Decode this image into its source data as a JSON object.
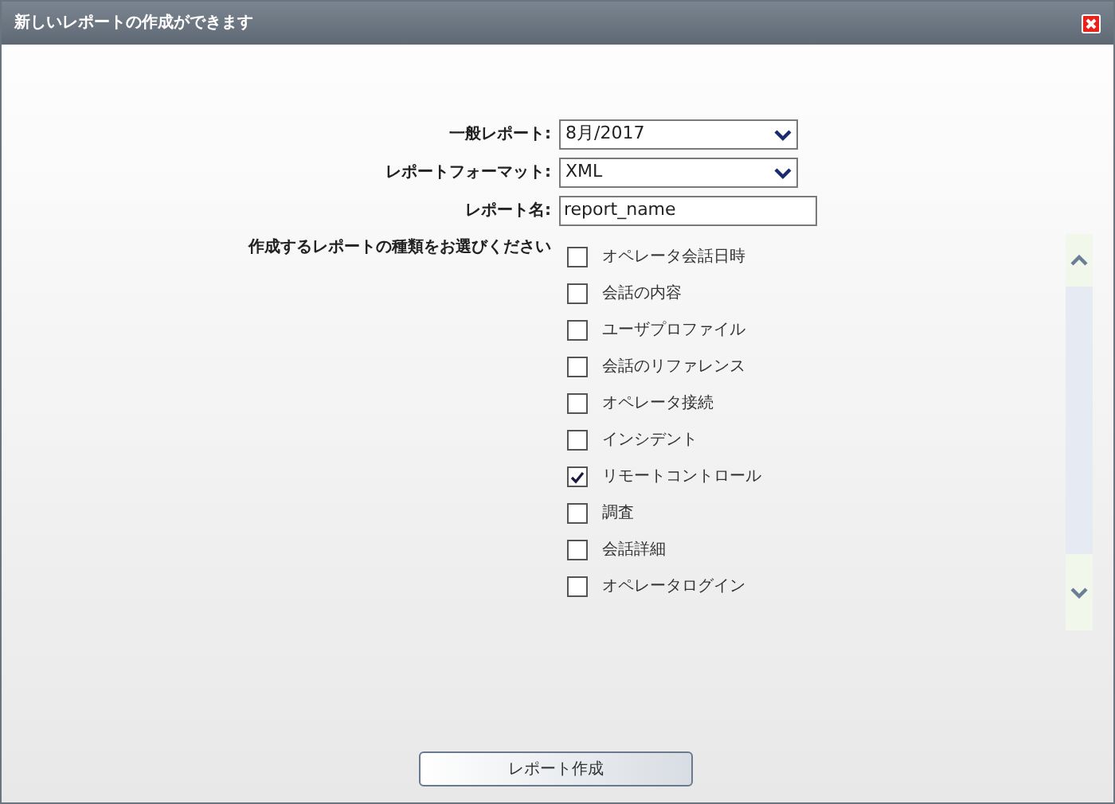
{
  "window": {
    "title": "新しいレポートの作成ができます"
  },
  "fields": [
    {
      "kind": "select",
      "label": "一般レポート:",
      "value": "8月/2017"
    },
    {
      "kind": "select",
      "label": "レポートフォーマット:",
      "value": "XML"
    },
    {
      "kind": "text",
      "label": "レポート名:",
      "value": "report_name"
    }
  ],
  "report_types": {
    "label": "作成するレポートの種類をお選びください",
    "items": [
      {
        "label": "オペレータ会話日時",
        "checked": false
      },
      {
        "label": "会話の内容",
        "checked": false
      },
      {
        "label": "ユーザプロファイル",
        "checked": false
      },
      {
        "label": "会話のリファレンス",
        "checked": false
      },
      {
        "label": "オペレータ接続",
        "checked": false
      },
      {
        "label": "インシデント",
        "checked": false
      },
      {
        "label": "リモートコントロール",
        "checked": true
      },
      {
        "label": "調査",
        "checked": false
      },
      {
        "label": "会話詳細",
        "checked": false
      },
      {
        "label": "オペレータログイン",
        "checked": false
      }
    ]
  },
  "submit_button": "レポート作成"
}
